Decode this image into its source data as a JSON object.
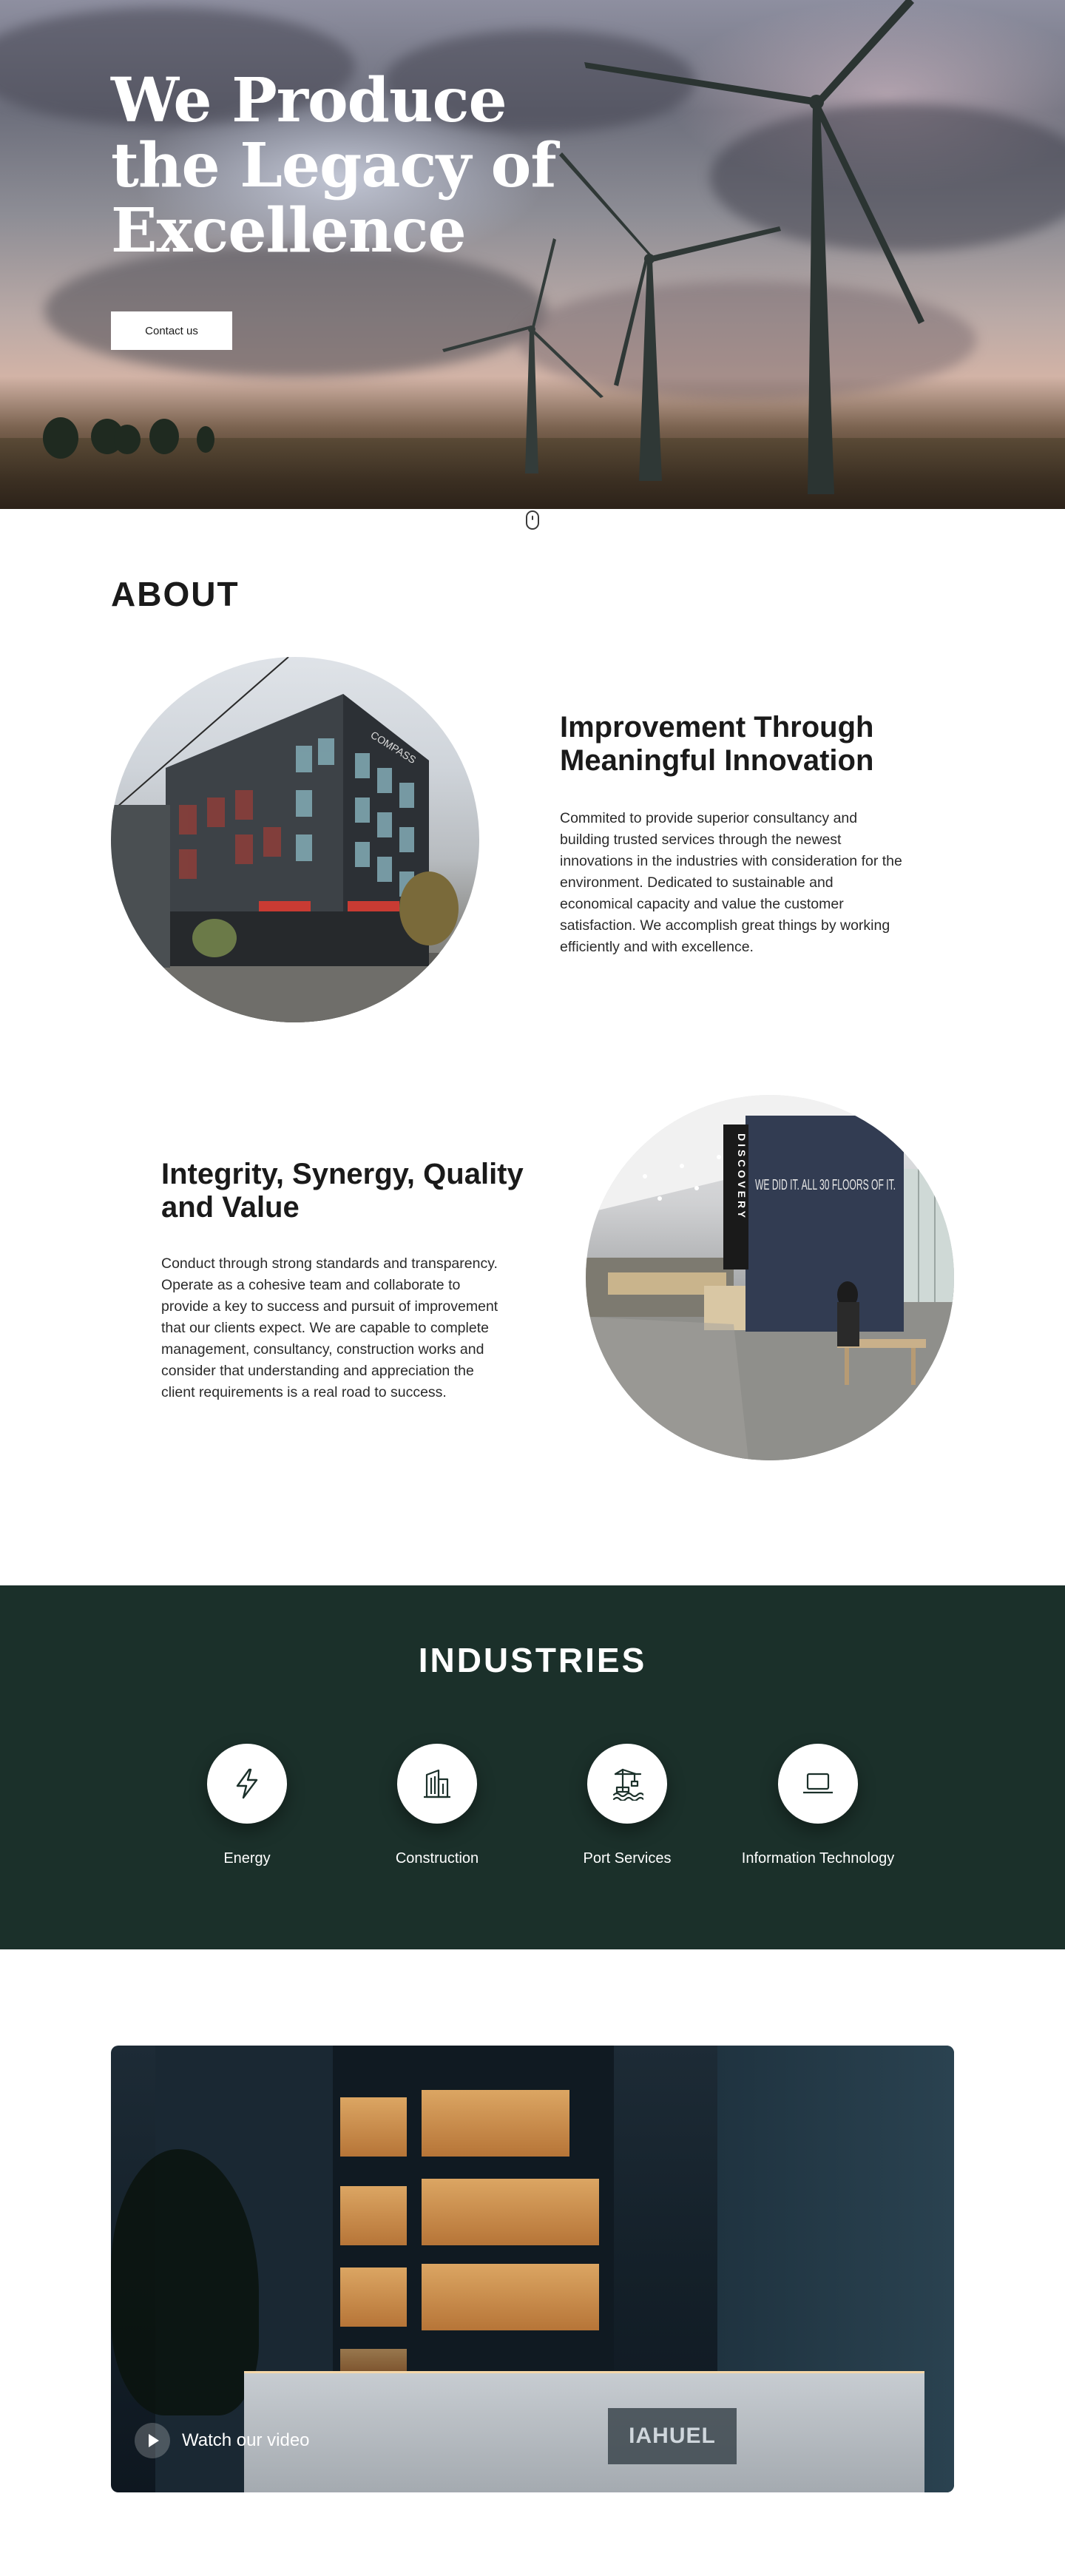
{
  "hero": {
    "title": "We Produce the Legacy of Excellence",
    "button_label": "Contact us"
  },
  "about": {
    "heading": "ABOUT",
    "block1": {
      "title": "Improvement Through Meaningful Innovation",
      "text": "Commited to provide superior consultancy and building trusted services through the newest innovations in the industries with consideration for the environment. Dedicated to sustainable and economical capacity and value the customer satisfaction. We accomplish great things by working efficiently and with excellence.",
      "image_sign_text": "COMPASS"
    },
    "block2": {
      "title": "Integrity, Synergy, Quality and Value",
      "text": "Conduct through strong standards and transparency. Operate as a cohesive team and collaborate to provide a key to success and pursuit of improvement that our clients expect. We are capable to complete management, consultancy, construction works and consider that understanding and appreciation the client requirements is a real road to success.",
      "image_banner_text": "DISCOVERY",
      "image_wall_text": "WE DID IT. ALL 30 FLOORS OF IT."
    }
  },
  "industries": {
    "heading": "INDUSTRIES",
    "items": [
      {
        "label": "Energy",
        "icon": "lightning-icon"
      },
      {
        "label": "Construction",
        "icon": "building-icon"
      },
      {
        "label": "Port Services",
        "icon": "crane-icon"
      },
      {
        "label": "Information Technology",
        "icon": "laptop-icon"
      }
    ]
  },
  "video": {
    "label": "Watch our video",
    "sign_text": "IAHUEL"
  },
  "colors": {
    "industries_bg": "#1b302a",
    "text": "#1a1a1a",
    "white": "#ffffff"
  }
}
